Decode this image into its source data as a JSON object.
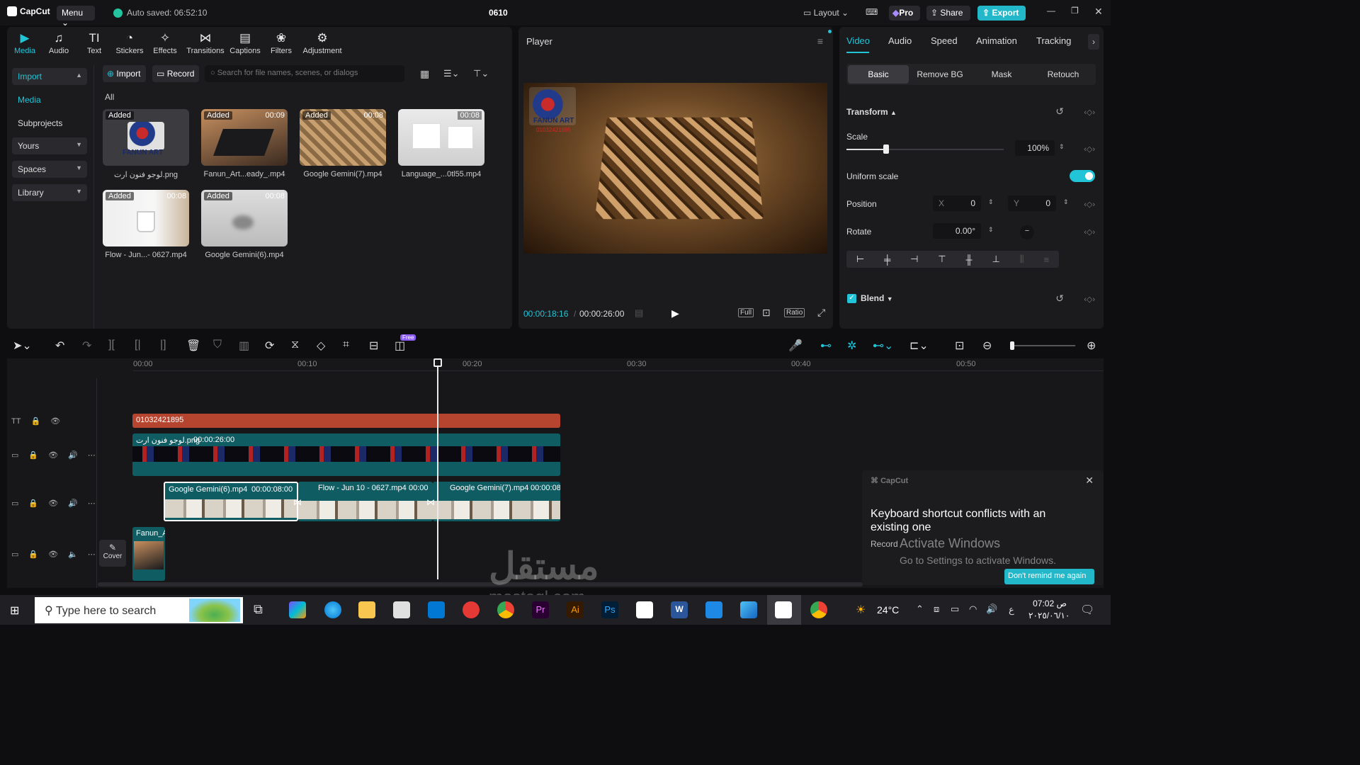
{
  "app": {
    "name": "CapCut",
    "menu": "Menu",
    "autosave": "Auto saved: 06:52:10",
    "project": "0610",
    "layout": "Layout",
    "pro": "Pro",
    "share": "Share",
    "export": "Export"
  },
  "media_tools": [
    "Media",
    "Audio",
    "Text",
    "Stickers",
    "Effects",
    "Transitions",
    "Captions",
    "Filters",
    "Adjustment"
  ],
  "media_sidebar": {
    "import": "Import",
    "media": "Media",
    "subprojects": "Subprojects",
    "yours": "Yours",
    "spaces": "Spaces",
    "library": "Library"
  },
  "media_actions": {
    "import": "Import",
    "record": "Record",
    "search_placeholder": "Search for file names, scenes, or dialogs",
    "filter_all": "All"
  },
  "media_items": [
    {
      "label": "لوجو فنون ارت.png",
      "added": "Added",
      "duration": ""
    },
    {
      "label": "Fanun_Art...eady_.mp4",
      "added": "Added",
      "duration": "00:09"
    },
    {
      "label": "Google Gemini(7).mp4",
      "added": "Added",
      "duration": "00:08"
    },
    {
      "label": "Language_...0tl55.mp4",
      "added": "",
      "duration": "00:08"
    },
    {
      "label": "Flow - Jun...- 0627.mp4",
      "added": "Added",
      "duration": "00:08"
    },
    {
      "label": "Google Gemini(6).mp4",
      "added": "Added",
      "duration": "00:08"
    }
  ],
  "player": {
    "title": "Player",
    "current": "00:00:18:16",
    "total": "00:00:26:00",
    "full": "Full",
    "ratio": "Ratio",
    "logo_text": "FANUN ART",
    "logo_phone": "01032421895"
  },
  "props": {
    "tabs": [
      "Video",
      "Audio",
      "Speed",
      "Animation",
      "Tracking"
    ],
    "subtabs": [
      "Basic",
      "Remove BG",
      "Mask",
      "Retouch"
    ],
    "transform": "Transform",
    "scale_label": "Scale",
    "scale": "100%",
    "scale_fraction": 0.25,
    "uniform": "Uniform scale",
    "position": "Position",
    "x_label": "X",
    "x": "0",
    "y_label": "Y",
    "y": "0",
    "rotate": "Rotate",
    "rotate_val": "0.00°",
    "blend": "Blend"
  },
  "toolbar": {
    "free_badge": "Free"
  },
  "timeline": {
    "ticks": [
      "00:00",
      "00:10",
      "00:20",
      "00:30",
      "00:40",
      "00:50"
    ],
    "text_clip": "01032421895",
    "logo_clip": "لوجو فنون ارت.png",
    "logo_dur": "00:00:26:00",
    "clips": [
      {
        "name": "Google Gemini(6).mp4",
        "dur": "00:00:08:00"
      },
      {
        "name": "Flow - Jun 10 - 0627.mp4",
        "dur": "00:00"
      },
      {
        "name": "Google Gemini(7).mp4",
        "dur": "00:00:08"
      }
    ],
    "main_clip": "Fanun_A",
    "cover": "Cover"
  },
  "notification": {
    "brand": "CapCut",
    "title": "Keyboard shortcut conflicts with an existing one",
    "body": "Record",
    "button": "Don't remind me again"
  },
  "watermark": {
    "text": "مستقل",
    "domain": "mostaql.com"
  },
  "activate": {
    "title": "Activate Windows",
    "sub": "Go to Settings to activate Windows."
  },
  "taskbar": {
    "search": "Type here to search",
    "temp": "24°C",
    "lang": "ع",
    "time": "07:02 ص",
    "date": "٢٠٢٥/٠٦/١٠"
  }
}
